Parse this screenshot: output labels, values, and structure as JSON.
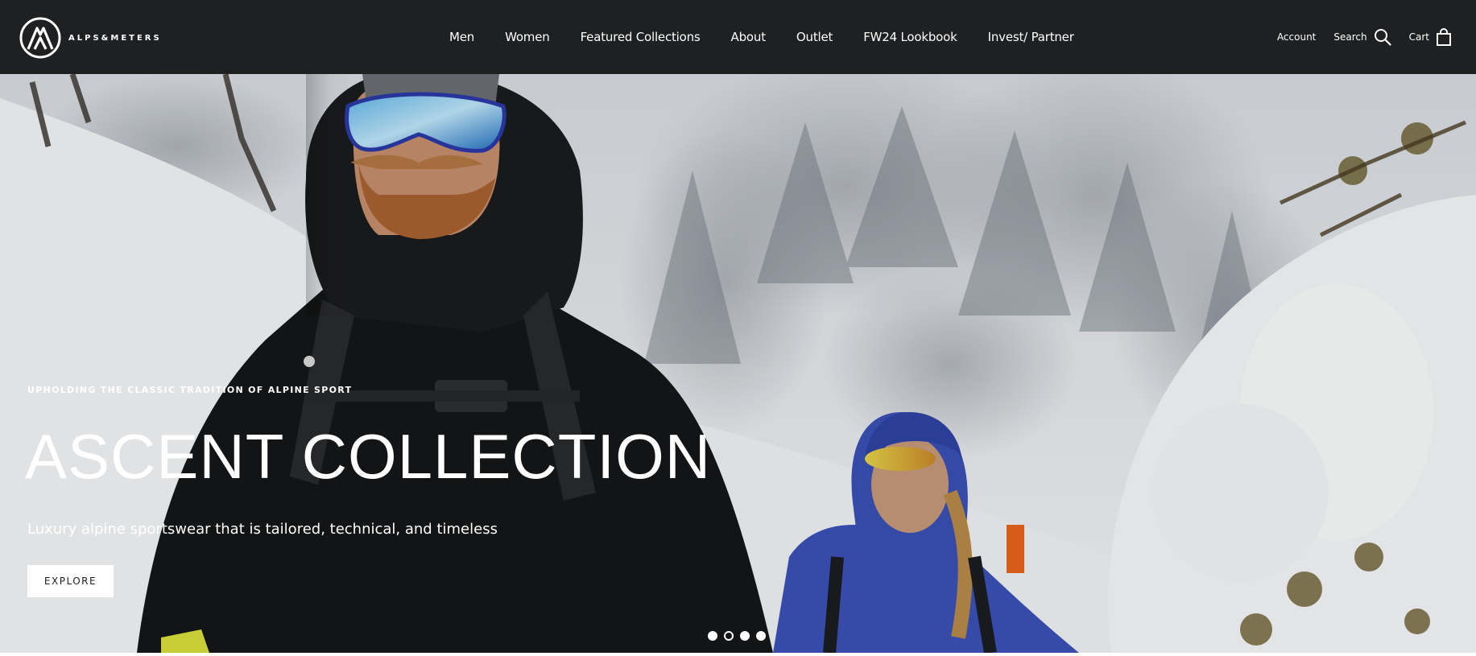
{
  "header": {
    "logo_text": "ALPS&METERS",
    "nav": [
      {
        "label": "Men"
      },
      {
        "label": "Women"
      },
      {
        "label": "Featured Collections"
      },
      {
        "label": "About"
      },
      {
        "label": "Outlet"
      },
      {
        "label": "FW24 Lookbook"
      },
      {
        "label": "Invest/ Partner"
      }
    ],
    "account_label": "Account",
    "search_label": "Search",
    "cart_label": "Cart"
  },
  "hero": {
    "eyebrow": "UPHOLDING THE CLASSIC TRADITION OF ALPINE SPORT",
    "headline": "ASCENT COLLECTION",
    "subhead": "Luxury alpine sportswear that is tailored, technical, and timeless",
    "cta_label": "EXPLORE",
    "slides_total": 4,
    "active_slide": 2
  },
  "colors": {
    "header_bg": "#1e2022",
    "text_light": "#ffffff",
    "jacket_blue": "#3b52b8",
    "jacket_black": "#151617"
  }
}
